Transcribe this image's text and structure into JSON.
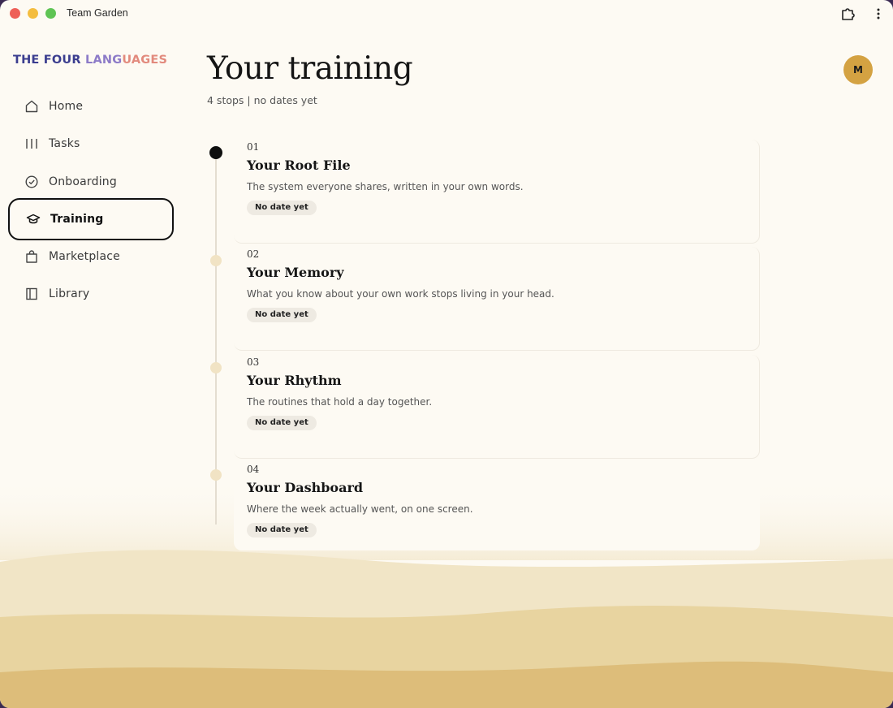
{
  "window": {
    "title": "Team Garden"
  },
  "brand": {
    "part1": "THE FOUR ",
    "part2": "LANG",
    "part3": "UAGES"
  },
  "sidebar": {
    "items": [
      {
        "label": "Home",
        "icon": "home-icon"
      },
      {
        "label": "Tasks",
        "icon": "tasks-icon"
      },
      {
        "label": "Onboarding",
        "icon": "check-circle-icon"
      },
      {
        "label": "Training",
        "icon": "graduation-cap-icon",
        "active": true
      },
      {
        "label": "Marketplace",
        "icon": "shopping-bag-icon"
      },
      {
        "label": "Library",
        "icon": "book-icon"
      }
    ]
  },
  "header": {
    "title": "Your training",
    "subtitle": "4 stops | no dates yet",
    "avatar_initial": "M"
  },
  "stops": [
    {
      "number": "01",
      "title": "Your Root File",
      "description": "The system everyone shares, written in your own words.",
      "badge": "No date yet"
    },
    {
      "number": "02",
      "title": "Your Memory",
      "description": "What you know about your own work stops living in your head.",
      "badge": "No date yet"
    },
    {
      "number": "03",
      "title": "Your Rhythm",
      "description": "The routines that hold a day together.",
      "badge": "No date yet"
    },
    {
      "number": "04",
      "title": "Your Dashboard",
      "description": "Where the week actually went, on one screen.",
      "badge": "No date yet"
    }
  ],
  "colors": {
    "background": "#fdfaf3",
    "avatar": "#d4a242",
    "active_dot": "#0f0f0f",
    "pending_dot": "#f1e3c4",
    "brand_dark": "#3b3d8f",
    "brand_mid": "#8d7bc8",
    "brand_warm": "#e28a7d"
  }
}
